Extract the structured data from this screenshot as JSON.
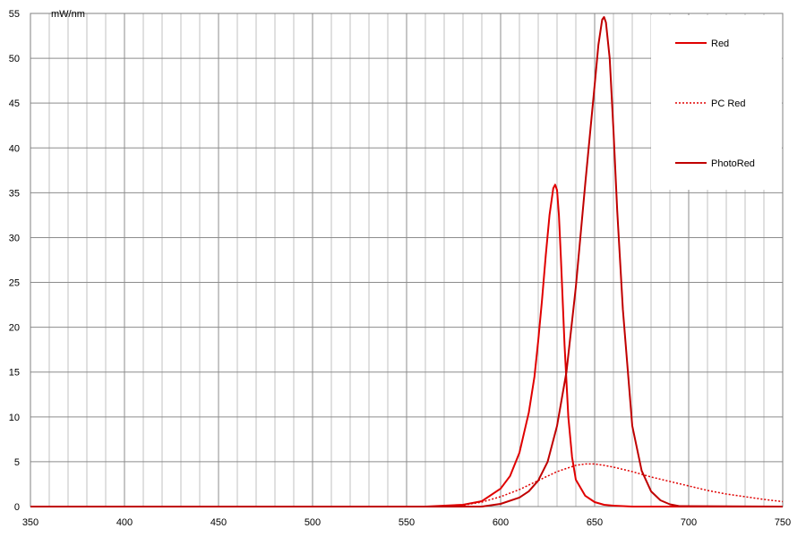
{
  "chart_data": {
    "type": "line",
    "unit_label": "mW/nm",
    "xlim": [
      350,
      750
    ],
    "ylim": [
      0,
      55
    ],
    "x_ticks": [
      350,
      400,
      450,
      500,
      550,
      600,
      650,
      700,
      750
    ],
    "y_ticks": [
      0,
      5,
      10,
      15,
      20,
      25,
      30,
      35,
      40,
      45,
      50,
      55
    ],
    "minor_x_step": 10,
    "grid": true,
    "legend_position": "top-right",
    "series": [
      {
        "name": "Red",
        "color": "#e00000",
        "style": "solid",
        "x": [
          350,
          560,
          580,
          590,
          600,
          605,
          610,
          615,
          618,
          620,
          622,
          624,
          626,
          628,
          629,
          630,
          631,
          632,
          634,
          636,
          638,
          640,
          645,
          650,
          655,
          660,
          670,
          680,
          750
        ],
        "y": [
          0,
          0,
          0.2,
          0.6,
          2.0,
          3.4,
          6.0,
          10.5,
          14.5,
          18.5,
          23.0,
          28.0,
          32.5,
          35.5,
          35.9,
          35.3,
          32.5,
          28.0,
          18.0,
          10.0,
          5.5,
          3.0,
          1.2,
          0.5,
          0.2,
          0.1,
          0,
          0,
          0
        ]
      },
      {
        "name": "PC Red",
        "color": "#e00000",
        "style": "dotted",
        "x": [
          350,
          570,
          580,
          590,
          600,
          610,
          620,
          630,
          640,
          645,
          650,
          655,
          660,
          670,
          680,
          690,
          700,
          710,
          720,
          730,
          740,
          750
        ],
        "y": [
          0,
          0.02,
          0.15,
          0.5,
          1.1,
          1.9,
          2.9,
          3.9,
          4.6,
          4.75,
          4.75,
          4.6,
          4.4,
          3.9,
          3.3,
          2.8,
          2.3,
          1.8,
          1.4,
          1.1,
          0.8,
          0.55
        ]
      },
      {
        "name": "PhotoRed",
        "color": "#c00000",
        "style": "solid",
        "x": [
          350,
          590,
          600,
          610,
          615,
          620,
          625,
          630,
          635,
          640,
          645,
          650,
          652,
          654,
          655,
          656,
          658,
          660,
          662,
          665,
          670,
          675,
          680,
          685,
          690,
          695,
          750
        ],
        "y": [
          0,
          0,
          0.3,
          1.0,
          1.7,
          2.9,
          5.0,
          9.0,
          15.0,
          24.5,
          36.0,
          47.0,
          51.5,
          54.3,
          54.6,
          54.0,
          50.0,
          42.0,
          33.0,
          22.0,
          9.0,
          4.0,
          1.7,
          0.7,
          0.25,
          0.05,
          0
        ]
      }
    ]
  }
}
